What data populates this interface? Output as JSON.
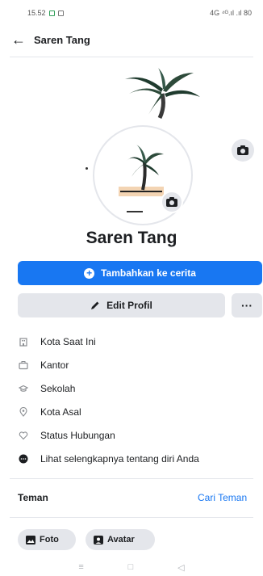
{
  "status_bar": {
    "time": "15.52",
    "right_indicators": "4G ⁴ᴳ.ıl .ıl 80"
  },
  "topbar": {
    "back_icon": "arrow-left-icon",
    "title": "Saren Tang"
  },
  "profile": {
    "name": "Saren Tang"
  },
  "actions": {
    "add_story_label": "Tambahkan ke cerita",
    "edit_profile_label": "Edit Profil",
    "more_label": "···"
  },
  "details": [
    {
      "icon": "building-icon",
      "label": "Kota Saat Ini"
    },
    {
      "icon": "briefcase-icon",
      "label": "Kantor"
    },
    {
      "icon": "graduation-cap-icon",
      "label": "Sekolah"
    },
    {
      "icon": "location-pin-icon",
      "label": "Kota Asal"
    },
    {
      "icon": "heart-icon",
      "label": "Status Hubungan"
    },
    {
      "icon": "dots-circle-icon",
      "label": "Lihat selengkapnya tentang diri Anda"
    }
  ],
  "friends": {
    "label": "Teman",
    "find_label": "Cari Teman"
  },
  "chips": {
    "photo_label": "Foto",
    "avatar_label": "Avatar"
  },
  "colors": {
    "accent": "#1877f2",
    "button_gray": "#e4e6eb",
    "text": "#1c1e21"
  }
}
